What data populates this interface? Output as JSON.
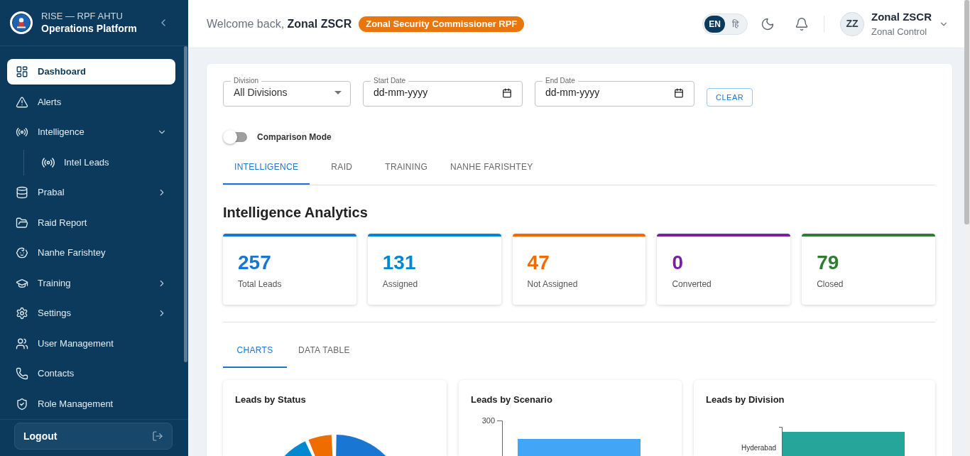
{
  "sidebar": {
    "app_title": "RISE — RPF AHTU",
    "app_subtitle": "Operations Platform",
    "items": [
      {
        "kind": "link",
        "label": "Dashboard",
        "selected": true
      },
      {
        "kind": "link",
        "label": "Alerts",
        "selected": false
      },
      {
        "kind": "group",
        "label": "Intelligence",
        "selected": false,
        "expanded": true,
        "children": [
          {
            "label": "Intel Leads",
            "selected": false
          }
        ]
      },
      {
        "kind": "group",
        "label": "Prabal",
        "selected": false,
        "expanded": false
      },
      {
        "kind": "link",
        "label": "Raid Report",
        "selected": false
      },
      {
        "kind": "link",
        "label": "Nanhe Farishtey",
        "selected": false
      },
      {
        "kind": "group",
        "label": "Training",
        "selected": false,
        "expanded": false
      },
      {
        "kind": "group",
        "label": "Settings",
        "selected": false,
        "expanded": false
      },
      {
        "kind": "link",
        "label": "User Management",
        "selected": false
      },
      {
        "kind": "link",
        "label": "Contacts",
        "selected": false
      },
      {
        "kind": "link",
        "label": "Role Management",
        "selected": false
      }
    ],
    "logout": "Logout"
  },
  "header": {
    "welcome": "Welcome back, **Zonal ZSCR**",
    "role_badge": "Zonal Security Commissioner RPF",
    "languages": [
      {
        "label": "EN",
        "selected": true
      },
      {
        "label": "हि",
        "selected": false
      }
    ],
    "user": {
      "initials": "ZZ",
      "name": "Zonal ZSCR",
      "role": "Zonal Control"
    }
  },
  "filters": {
    "fields": [
      {
        "kind": "select",
        "label": "Division",
        "value": "All Divisions"
      },
      {
        "kind": "date",
        "label": "Start Date",
        "placeholder": "dd-mm-yyyy"
      },
      {
        "kind": "date",
        "label": "End Date",
        "placeholder": "dd-mm-yyyy"
      }
    ],
    "clear_button": "CLEAR"
  },
  "comparison_mode": {
    "label": "Comparison Mode",
    "on": false
  },
  "tabs": [
    {
      "label": "INTELLIGENCE",
      "selected": true
    },
    {
      "label": "RAID",
      "selected": false
    },
    {
      "label": "TRAINING",
      "selected": false
    },
    {
      "label": "NANHE FARISHTEY",
      "selected": false
    }
  ],
  "section_title": "Intelligence Analytics",
  "stats": [
    {
      "value": "257",
      "label": "Total Leads",
      "color": "#1976d2"
    },
    {
      "value": "131",
      "label": "Assigned",
      "color": "#0288d1"
    },
    {
      "value": "47",
      "label": "Not Assigned",
      "color": "#ef6c00"
    },
    {
      "value": "0",
      "label": "Converted",
      "color": "#7b1fa2"
    },
    {
      "value": "79",
      "label": "Closed",
      "color": "#2e7d32"
    }
  ],
  "view_tabs": [
    {
      "label": "CHARTS",
      "selected": true
    },
    {
      "label": "DATA TABLE",
      "selected": false
    }
  ],
  "charts": [
    {
      "kind": "pie",
      "title": "Leads by Status"
    },
    {
      "kind": "bar",
      "title": "Leads by Scenario",
      "y_tick": "300"
    },
    {
      "kind": "hbar",
      "title": "Leads by Division",
      "category": "Hyderabad"
    }
  ]
}
